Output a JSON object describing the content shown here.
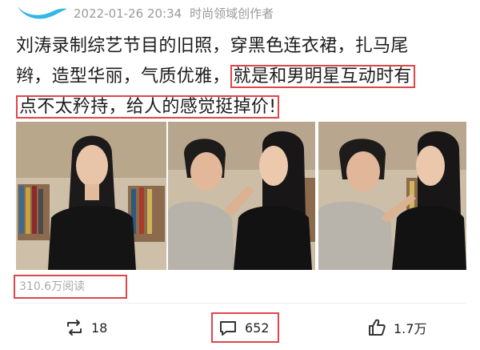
{
  "header": {
    "date": "2022-01-26 20:34",
    "author_label": "时尚领域创作者"
  },
  "body": {
    "line1": "刘涛录制综艺节目的旧照，穿黑色连衣裙，扎马尾",
    "line2_plain": "辫，造型华丽，气质优雅，",
    "line2_highlight": "就是和男明星互动时有",
    "line3_highlight": "点不太矜持，给人的感觉挺掉价!"
  },
  "stats": {
    "reads": "310.6万阅读"
  },
  "actions": {
    "share_count": "18",
    "comment_count": "652",
    "like_count": "1.7万"
  },
  "colors": {
    "highlight_border": "#e0454a",
    "meta_text": "#9a9a9a"
  },
  "icons": [
    "bird-logo-icon",
    "repost-icon",
    "comment-icon",
    "like-icon"
  ]
}
